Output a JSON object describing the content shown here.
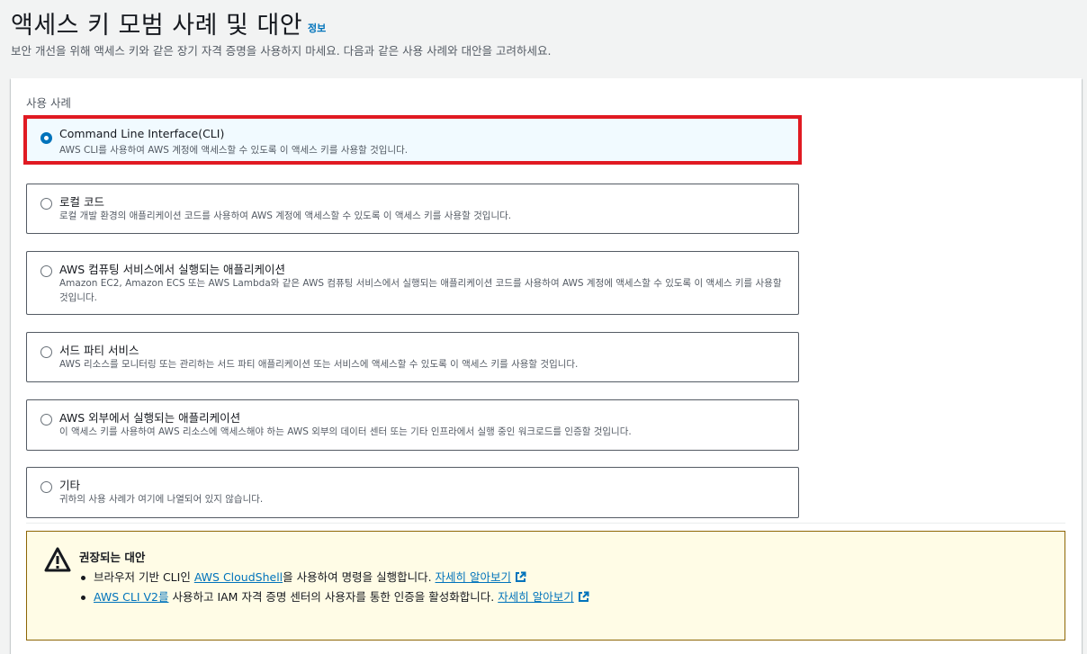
{
  "header": {
    "title": "액세스 키 모범 사례 및 대안",
    "info_link": "정보",
    "description": "보안 개선을 위해 액세스 키와 같은 장기 자격 증명을 사용하지 마세요. 다음과 같은 사용 사례와 대안을 고려하세요."
  },
  "use_case": {
    "section_label": "사용 사례",
    "options": [
      {
        "title": "Command Line Interface(CLI)",
        "description": "AWS CLI를 사용하여 AWS 계정에 액세스할 수 있도록 이 액세스 키를 사용할 것입니다.",
        "selected": true
      },
      {
        "title": "로컬 코드",
        "description": "로컬 개발 환경의 애플리케이션 코드를 사용하여 AWS 계정에 액세스할 수 있도록 이 액세스 키를 사용할 것입니다.",
        "selected": false
      },
      {
        "title": "AWS 컴퓨팅 서비스에서 실행되는 애플리케이션",
        "description": "Amazon EC2, Amazon ECS 또는 AWS Lambda와 같은 AWS 컴퓨팅 서비스에서 실행되는 애플리케이션 코드를 사용하여 AWS 계정에 액세스할 수 있도록 이 액세스 키를 사용할 것입니다.",
        "selected": false
      },
      {
        "title": "서드 파티 서비스",
        "description": "AWS 리소스를 모니터링 또는 관리하는 서드 파티 애플리케이션 또는 서비스에 액세스할 수 있도록 이 액세스 키를 사용할 것입니다.",
        "selected": false
      },
      {
        "title": "AWS 외부에서 실행되는 애플리케이션",
        "description": "이 액세스 키를 사용하여 AWS 리소스에 액세스해야 하는 AWS 외부의 데이터 센터 또는 기타 인프라에서 실행 중인 워크로드를 인증할 것입니다.",
        "selected": false
      },
      {
        "title": "기타",
        "description": "귀하의 사용 사례가 여기에 나열되어 있지 않습니다.",
        "selected": false
      }
    ]
  },
  "alert": {
    "title": "권장되는 대안",
    "item1": {
      "prefix": "브라우저 기반 CLI인 ",
      "link": "AWS CloudShell",
      "suffix": "을 사용하여 명령을 실행합니다. ",
      "learn_more": "자세히 알아보기"
    },
    "item2": {
      "link": "AWS CLI V2를",
      "suffix": " 사용하고 IAM 자격 증명 센터의 사용자를 통한 인증을 활성화합니다. ",
      "learn_more": "자세히 알아보기"
    }
  },
  "colors": {
    "accent": "#0073bb",
    "highlight": "#e01a22",
    "warning_bg": "#fffce6"
  }
}
